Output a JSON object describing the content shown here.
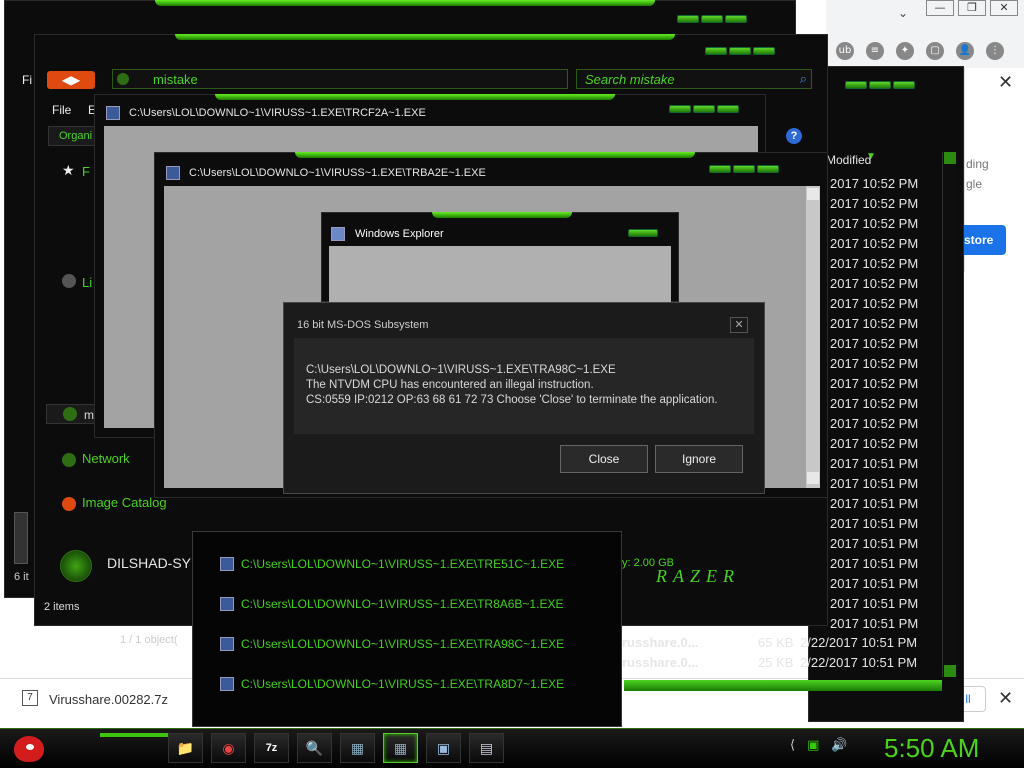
{
  "browser": {
    "window_controls": [
      "—",
      "❐",
      "✕"
    ],
    "dropdown": "⌄",
    "extensions": [
      "ub",
      "≡",
      "✦",
      "▢",
      "👤",
      "⋮"
    ],
    "popup_close": "✕",
    "popup_text1": "ding",
    "popup_text2": "gle",
    "popup_button": "store"
  },
  "download_bar": {
    "file": "Virusshare.00282.7z",
    "show_all": "ll",
    "close": "✕"
  },
  "explorer_back": {
    "menu_letter": "Fi",
    "status_items": "6 it"
  },
  "explorer_main": {
    "address_text": "mistake",
    "search_placeholder": "Search mistake",
    "menu_file": "File",
    "menu_edit": "E",
    "organize": "Organi",
    "fav_label": "F",
    "lib_label": "Li",
    "network": "Network",
    "image_catalog": "Image Catalog",
    "computer_name": "DILSHAD-SY",
    "memory_text": "y: 2.00 GB",
    "status_items": "2 items",
    "details_label": "m",
    "razer_logo": "RAZER"
  },
  "file_list": {
    "column_header": "Modified",
    "dates": [
      "2017 10:52 PM",
      "2017 10:52 PM",
      "2017 10:52 PM",
      "2017 10:52 PM",
      "2017 10:52 PM",
      "2017 10:52 PM",
      "2017 10:52 PM",
      "2017 10:52 PM",
      "2017 10:52 PM",
      "2017 10:52 PM",
      "2017 10:52 PM",
      "2017 10:52 PM",
      "2017 10:52 PM",
      "2017 10:52 PM",
      "2017 10:51 PM",
      "2017 10:51 PM",
      "2017 10:51 PM",
      "2017 10:51 PM",
      "2017 10:51 PM",
      "2017 10:51 PM",
      "2017 10:51 PM",
      "2017 10:51 PM",
      "2017 10:51 PM"
    ],
    "named_rows": [
      {
        "name": "russhare.0...",
        "size": "65 KB",
        "date": "2/22/2017 10:51 PM"
      },
      {
        "name": "russhare.0...",
        "size": "25 KB",
        "date": "2/22/2017 10:51 PM"
      }
    ],
    "object_count": "1 / 1 object("
  },
  "window_trcf": {
    "title": "C:\\Users\\LOL\\DOWNLO~1\\VIRUSS~1.EXE\\TRCF2A~1.EXE"
  },
  "window_trba": {
    "title": "C:\\Users\\LOL\\DOWNLO~1\\VIRUSS~1.EXE\\TRBA2E~1.EXE"
  },
  "window_explorer_small": {
    "title": "Windows Explorer"
  },
  "dos_dialog": {
    "title": "16 bit MS-DOS Subsystem",
    "close": "✕",
    "line1": "C:\\Users\\LOL\\DOWNLO~1\\VIRUSS~1.EXE\\TRA98C~1.EXE",
    "line2": "The NTVDM CPU has encountered an illegal instruction.",
    "line3": "CS:0559 IP:0212 OP:63 68 61 72 73 Choose 'Close' to terminate the application.",
    "close_button": "Close",
    "ignore_button": "Ignore"
  },
  "thumbnails": [
    "C:\\Users\\LOL\\DOWNLO~1\\VIRUSS~1.EXE\\TRE51C~1.EXE",
    "C:\\Users\\LOL\\DOWNLO~1\\VIRUSS~1.EXE\\TR8A6B~1.EXE",
    "C:\\Users\\LOL\\DOWNLO~1\\VIRUSS~1.EXE\\TRA98C~1.EXE",
    "C:\\Users\\LOL\\DOWNLO~1\\VIRUSS~1.EXE\\TRA8D7~1.EXE"
  ],
  "taskbar": {
    "apps": [
      "📁",
      "◉",
      "7z",
      "🔍",
      "▦",
      "▦",
      "▣",
      "▤"
    ],
    "tray": [
      "⟨",
      "▣",
      "🔊"
    ],
    "clock": "5:50 AM"
  }
}
